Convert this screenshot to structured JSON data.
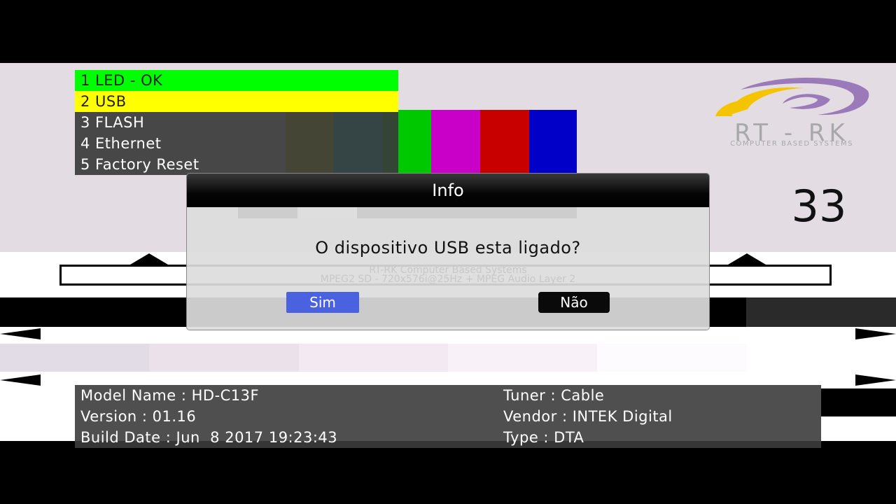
{
  "menu": {
    "items": [
      {
        "label": "1 LED - OK"
      },
      {
        "label": "2 USB"
      },
      {
        "label": "3 FLASH"
      },
      {
        "label": "4 Ethernet"
      },
      {
        "label": "5 Factory Reset"
      }
    ]
  },
  "logo": {
    "title": "RT - RK",
    "subtitle": "COMPUTER BASED SYSTEMS"
  },
  "channel_number": "33",
  "dialog": {
    "title": "Info",
    "message": "O dispositivo USB esta ligado?",
    "background_text_1": "RT-RK Computer Based Systems",
    "background_text_2": "MPEG2 SD - 720x576i@25Hz + MPEG Audio Layer 2",
    "yes_label": "Sim",
    "no_label": "Não"
  },
  "info": {
    "model_name": "Model Name : HD-C13F",
    "version": "Version : 01.16",
    "build_date": "Build Date : Jun  8 2017 19:23:43",
    "tuner": "Tuner : Cable",
    "vendor": "Vendor : INTEK Digital",
    "type": "Type : DTA"
  },
  "colors": {
    "led_ok": "#00ff00",
    "selected": "#ffff00",
    "sim_button": "#4a62e0",
    "bar_green": "#00c800",
    "bar_magenta": "#c800c8",
    "bar_red": "#c80000",
    "bar_blue": "#0000c8"
  }
}
